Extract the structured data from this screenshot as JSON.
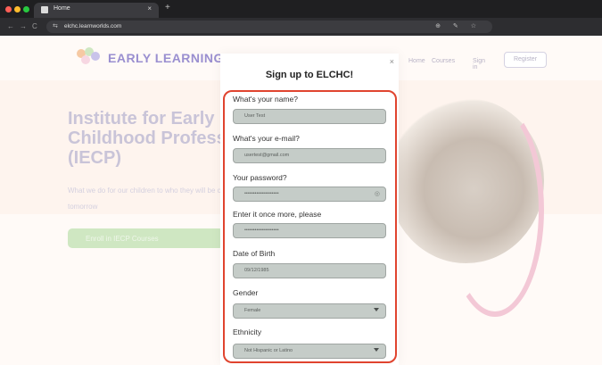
{
  "browser": {
    "tab_title": "Home",
    "tab_close": "×",
    "new_tab": "+",
    "url": "elchc.learnworlds.com",
    "nav_back": "←",
    "nav_forward": "→",
    "nav_reload": "C",
    "site_info": "⇆",
    "omni_actions": "⊕ ✎ ☆"
  },
  "site": {
    "logo_text": "EARLY LEARNING",
    "nav": {
      "home": "Home",
      "courses": "Courses",
      "signin": "Sign in"
    },
    "register": "Register",
    "hero_title": "Institute for Early Childhood Professi (IECP)",
    "hero_sub": "What we do for our children to who they will be come tomorrow",
    "hero_cta": "Enroll in IECP Courses"
  },
  "modal": {
    "title": "Sign up to ELCHC!",
    "close": "×",
    "fields": [
      {
        "label": "What's your name?",
        "value": "User Test"
      },
      {
        "label": "What's your e-mail?",
        "value": "usertest@gmail.com"
      },
      {
        "label": "Your password?",
        "value": "••••••••••••••••••••"
      },
      {
        "label": "Enter it once more, please",
        "value": "••••••••••••••••••••"
      },
      {
        "label": "Date of Birth",
        "value": "09/12/1985"
      },
      {
        "label": "Gender",
        "value": "Female"
      },
      {
        "label": "Ethnicity",
        "value": "Not Hispanic or Latino"
      }
    ],
    "eye_icon": "◎"
  },
  "colors": {
    "highlight": "#e0442f",
    "field_bg": "#c5ccc8",
    "logo": "#9a8fd0"
  }
}
